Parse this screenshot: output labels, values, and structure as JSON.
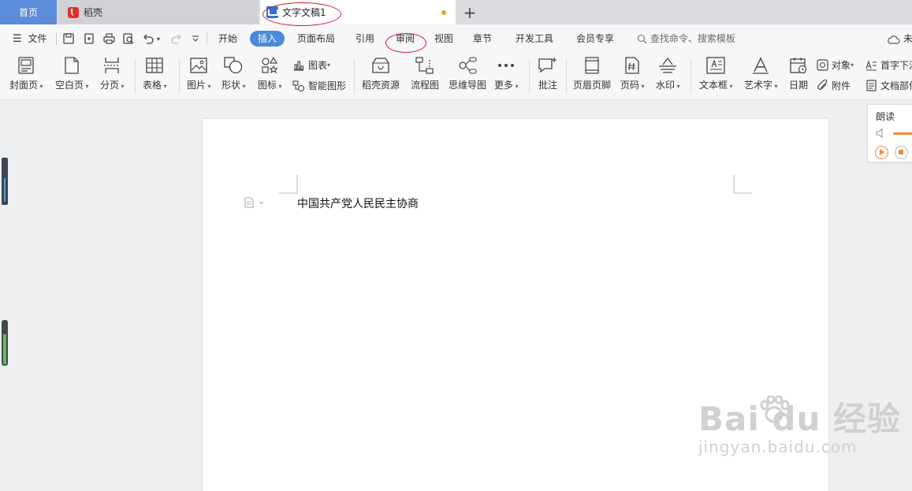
{
  "tabs": {
    "home": "首页",
    "daoke": "稻壳",
    "document": "文字文稿1",
    "add": "+"
  },
  "menu": {
    "file": "文件",
    "items": [
      "开始",
      "插入",
      "页面布局",
      "引用",
      "审阅",
      "视图",
      "章节",
      "开发工具",
      "会员专享"
    ],
    "active": "插入",
    "search": "查找命令、搜索模板",
    "cloud_partial": "未"
  },
  "ribbon": {
    "cover": "封面页",
    "blank": "空白页",
    "pagebreak": "分页",
    "table": "表格",
    "picture": "图片",
    "shape": "形状",
    "icon": "图标",
    "chart": "图表",
    "smartart": "智能图形",
    "daoke_res": "稻壳资源",
    "flowchart": "流程图",
    "mindmap": "思维导图",
    "more": "更多",
    "comment": "批注",
    "header_footer": "页眉页脚",
    "page_number": "页码",
    "watermark": "水印",
    "textbox": "文本框",
    "wordart": "艺术字",
    "date": "日期",
    "object": "对象",
    "attachment": "附件",
    "dropcap": "首字下沉",
    "docparts": "文档部件"
  },
  "document": {
    "text": "中国共产党人民民主协商"
  },
  "read_panel": {
    "title": "朗读"
  },
  "watermark": {
    "main": "Bai  du 经验",
    "url": "jingyan.baidu.com"
  },
  "colors": {
    "accent": "#4a89dc",
    "home_tab": "#5b8bd9",
    "annotation": "#d0202a",
    "orange": "#f08a3c"
  }
}
